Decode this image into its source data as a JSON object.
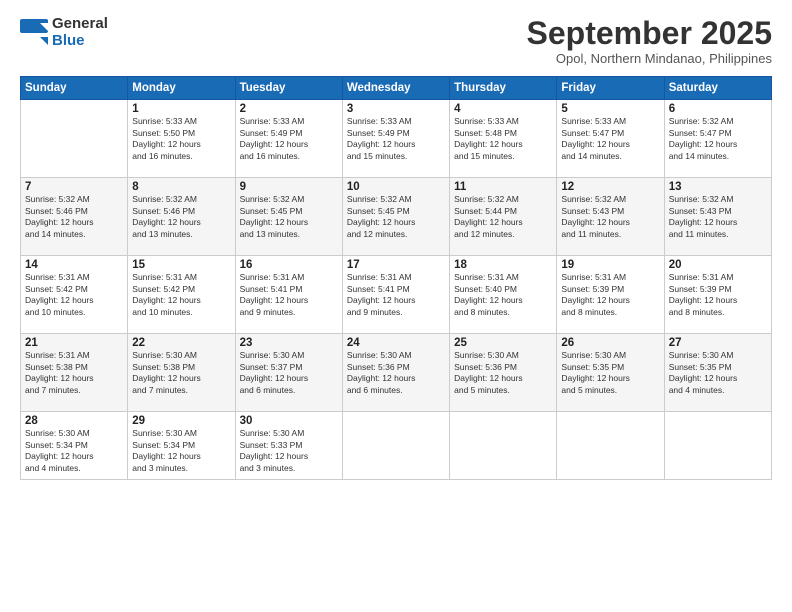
{
  "header": {
    "logo_general": "General",
    "logo_blue": "Blue",
    "month_title": "September 2025",
    "subtitle": "Opol, Northern Mindanao, Philippines"
  },
  "days_of_week": [
    "Sunday",
    "Monday",
    "Tuesday",
    "Wednesday",
    "Thursday",
    "Friday",
    "Saturday"
  ],
  "weeks": [
    [
      {
        "day": "",
        "info": ""
      },
      {
        "day": "1",
        "info": "Sunrise: 5:33 AM\nSunset: 5:50 PM\nDaylight: 12 hours\nand 16 minutes."
      },
      {
        "day": "2",
        "info": "Sunrise: 5:33 AM\nSunset: 5:49 PM\nDaylight: 12 hours\nand 16 minutes."
      },
      {
        "day": "3",
        "info": "Sunrise: 5:33 AM\nSunset: 5:49 PM\nDaylight: 12 hours\nand 15 minutes."
      },
      {
        "day": "4",
        "info": "Sunrise: 5:33 AM\nSunset: 5:48 PM\nDaylight: 12 hours\nand 15 minutes."
      },
      {
        "day": "5",
        "info": "Sunrise: 5:33 AM\nSunset: 5:47 PM\nDaylight: 12 hours\nand 14 minutes."
      },
      {
        "day": "6",
        "info": "Sunrise: 5:32 AM\nSunset: 5:47 PM\nDaylight: 12 hours\nand 14 minutes."
      }
    ],
    [
      {
        "day": "7",
        "info": "Sunrise: 5:32 AM\nSunset: 5:46 PM\nDaylight: 12 hours\nand 14 minutes."
      },
      {
        "day": "8",
        "info": "Sunrise: 5:32 AM\nSunset: 5:46 PM\nDaylight: 12 hours\nand 13 minutes."
      },
      {
        "day": "9",
        "info": "Sunrise: 5:32 AM\nSunset: 5:45 PM\nDaylight: 12 hours\nand 13 minutes."
      },
      {
        "day": "10",
        "info": "Sunrise: 5:32 AM\nSunset: 5:45 PM\nDaylight: 12 hours\nand 12 minutes."
      },
      {
        "day": "11",
        "info": "Sunrise: 5:32 AM\nSunset: 5:44 PM\nDaylight: 12 hours\nand 12 minutes."
      },
      {
        "day": "12",
        "info": "Sunrise: 5:32 AM\nSunset: 5:43 PM\nDaylight: 12 hours\nand 11 minutes."
      },
      {
        "day": "13",
        "info": "Sunrise: 5:32 AM\nSunset: 5:43 PM\nDaylight: 12 hours\nand 11 minutes."
      }
    ],
    [
      {
        "day": "14",
        "info": "Sunrise: 5:31 AM\nSunset: 5:42 PM\nDaylight: 12 hours\nand 10 minutes."
      },
      {
        "day": "15",
        "info": "Sunrise: 5:31 AM\nSunset: 5:42 PM\nDaylight: 12 hours\nand 10 minutes."
      },
      {
        "day": "16",
        "info": "Sunrise: 5:31 AM\nSunset: 5:41 PM\nDaylight: 12 hours\nand 9 minutes."
      },
      {
        "day": "17",
        "info": "Sunrise: 5:31 AM\nSunset: 5:41 PM\nDaylight: 12 hours\nand 9 minutes."
      },
      {
        "day": "18",
        "info": "Sunrise: 5:31 AM\nSunset: 5:40 PM\nDaylight: 12 hours\nand 8 minutes."
      },
      {
        "day": "19",
        "info": "Sunrise: 5:31 AM\nSunset: 5:39 PM\nDaylight: 12 hours\nand 8 minutes."
      },
      {
        "day": "20",
        "info": "Sunrise: 5:31 AM\nSunset: 5:39 PM\nDaylight: 12 hours\nand 8 minutes."
      }
    ],
    [
      {
        "day": "21",
        "info": "Sunrise: 5:31 AM\nSunset: 5:38 PM\nDaylight: 12 hours\nand 7 minutes."
      },
      {
        "day": "22",
        "info": "Sunrise: 5:30 AM\nSunset: 5:38 PM\nDaylight: 12 hours\nand 7 minutes."
      },
      {
        "day": "23",
        "info": "Sunrise: 5:30 AM\nSunset: 5:37 PM\nDaylight: 12 hours\nand 6 minutes."
      },
      {
        "day": "24",
        "info": "Sunrise: 5:30 AM\nSunset: 5:36 PM\nDaylight: 12 hours\nand 6 minutes."
      },
      {
        "day": "25",
        "info": "Sunrise: 5:30 AM\nSunset: 5:36 PM\nDaylight: 12 hours\nand 5 minutes."
      },
      {
        "day": "26",
        "info": "Sunrise: 5:30 AM\nSunset: 5:35 PM\nDaylight: 12 hours\nand 5 minutes."
      },
      {
        "day": "27",
        "info": "Sunrise: 5:30 AM\nSunset: 5:35 PM\nDaylight: 12 hours\nand 4 minutes."
      }
    ],
    [
      {
        "day": "28",
        "info": "Sunrise: 5:30 AM\nSunset: 5:34 PM\nDaylight: 12 hours\nand 4 minutes."
      },
      {
        "day": "29",
        "info": "Sunrise: 5:30 AM\nSunset: 5:34 PM\nDaylight: 12 hours\nand 3 minutes."
      },
      {
        "day": "30",
        "info": "Sunrise: 5:30 AM\nSunset: 5:33 PM\nDaylight: 12 hours\nand 3 minutes."
      },
      {
        "day": "",
        "info": ""
      },
      {
        "day": "",
        "info": ""
      },
      {
        "day": "",
        "info": ""
      },
      {
        "day": "",
        "info": ""
      }
    ]
  ]
}
